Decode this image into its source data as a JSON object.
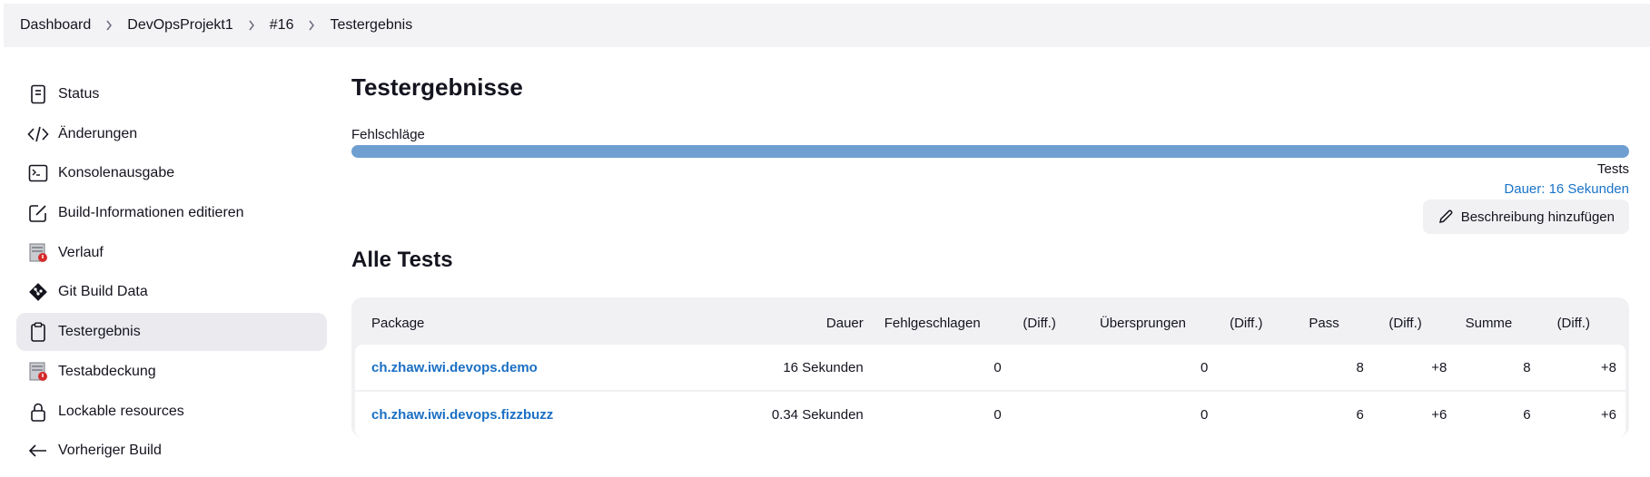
{
  "breadcrumb": [
    "Dashboard",
    "DevOpsProjekt1",
    "#16",
    "Testergebnis"
  ],
  "sidebar": {
    "items": [
      {
        "label": "Status",
        "icon": "document-icon"
      },
      {
        "label": "Änderungen",
        "icon": "code-icon"
      },
      {
        "label": "Konsolenausgabe",
        "icon": "terminal-icon"
      },
      {
        "label": "Build-Informationen editieren",
        "icon": "edit-icon"
      },
      {
        "label": "Verlauf",
        "icon": "history-icon"
      },
      {
        "label": "Git Build Data",
        "icon": "git-icon"
      },
      {
        "label": "Testergebnis",
        "icon": "clipboard-icon",
        "active": true
      },
      {
        "label": "Testabdeckung",
        "icon": "coverage-icon"
      },
      {
        "label": "Lockable resources",
        "icon": "lock-icon"
      },
      {
        "label": "Vorheriger Build",
        "icon": "arrow-left-icon"
      }
    ]
  },
  "main": {
    "title": "Testergebnisse",
    "fail_label": "Fehlschläge",
    "failure_fraction": 0,
    "tests_label": "Tests",
    "duration_link": "Dauer: 16 Sekunden",
    "add_description": "Beschreibung hinzufügen",
    "all_tests_title": "Alle Tests"
  },
  "table": {
    "headers": {
      "package": "Package",
      "dauer": "Dauer",
      "fehlgeschlagen": "Fehlgeschlagen",
      "diff1": "(Diff.)",
      "uebersprungen": "Übersprungen",
      "diff2": "(Diff.)",
      "pass": "Pass",
      "diff3": "(Diff.)",
      "summe": "Summe",
      "diff4": "(Diff.)"
    },
    "rows": [
      {
        "package": "ch.zhaw.iwi.devops.demo",
        "dauer": "16 Sekunden",
        "fehlgeschlagen": "0",
        "diff1": "",
        "uebersprungen": "0",
        "diff2": "",
        "pass": "8",
        "diff3": "+8",
        "summe": "8",
        "diff4": "+8"
      },
      {
        "package": "ch.zhaw.iwi.devops.fizzbuzz",
        "dauer": "0.34 Sekunden",
        "fehlgeschlagen": "0",
        "diff1": "",
        "uebersprungen": "0",
        "diff2": "",
        "pass": "6",
        "diff3": "+6",
        "summe": "6",
        "diff4": "+6"
      }
    ]
  },
  "colors": {
    "progress_fill": "#6f9fd1",
    "link": "#1a6fc4",
    "sidebar_active_bg": "#ebebef"
  }
}
